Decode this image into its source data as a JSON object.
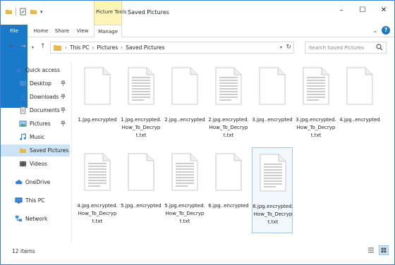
{
  "window": {
    "title": "Saved Pictures",
    "context_group": "Picture Tools",
    "controls": [
      "–",
      "☐",
      "✕"
    ]
  },
  "ribbon": {
    "tabs": [
      {
        "label": "File"
      },
      {
        "label": "Home"
      },
      {
        "label": "Share"
      },
      {
        "label": "View"
      },
      {
        "label": "Manage"
      }
    ],
    "expand_glyph": "⌄",
    "help_glyph": "?"
  },
  "address": {
    "crumbs": [
      "This PC",
      "Pictures",
      "Saved Pictures"
    ],
    "chevron": "›",
    "nav_back": "←",
    "nav_forward": "→",
    "nav_up": "↑",
    "nav_dropdown": "▾",
    "refresh": "↻"
  },
  "search": {
    "placeholder": "Search Saved Pictures"
  },
  "sidebar": {
    "items": [
      {
        "label": "Quick access",
        "icon": "star-icon",
        "pinned": false
      },
      {
        "label": "Desktop",
        "icon": "desktop-folder-icon",
        "pinned": true
      },
      {
        "label": "Downloads",
        "icon": "downloads-folder-icon",
        "pinned": true
      },
      {
        "label": "Documents",
        "icon": "documents-folder-icon",
        "pinned": true
      },
      {
        "label": "Pictures",
        "icon": "pictures-folder-icon",
        "pinned": true
      },
      {
        "label": "Music",
        "icon": "music-folder-icon",
        "pinned": false
      },
      {
        "label": "Saved Pictures",
        "icon": "folder-icon",
        "pinned": false,
        "selected": true
      },
      {
        "label": "Videos",
        "icon": "videos-folder-icon",
        "pinned": false
      },
      {
        "label": "OneDrive",
        "icon": "cloud-icon",
        "pinned": false
      },
      {
        "label": "This PC",
        "icon": "computer-icon",
        "pinned": false
      },
      {
        "label": "Network",
        "icon": "network-icon",
        "pinned": false
      }
    ]
  },
  "files": [
    {
      "name": "1.jpg.encrypted",
      "type": "blank"
    },
    {
      "name": "1.jpg.encrypted.How_To_Decrypt.txt",
      "type": "text"
    },
    {
      "name": "2.jpg..encrypted",
      "type": "blank"
    },
    {
      "name": "2.jpg.encrypted.How_To_Decrypt.txt",
      "type": "text"
    },
    {
      "name": "3.jpg..encrypted",
      "type": "blank"
    },
    {
      "name": "3.jpg.encrypted.How_To_Decrypt.txt",
      "type": "text"
    },
    {
      "name": "4.jpg..encrypted",
      "type": "blank"
    },
    {
      "name": "4.jpg.encrypted.How_To_Decrypt.txt",
      "type": "text"
    },
    {
      "name": "5.jpg..encrypted",
      "type": "blank"
    },
    {
      "name": "5.jpg.encrypted.How_To_Decrypt.txt",
      "type": "text"
    },
    {
      "name": "6.jpg..encrypted",
      "type": "blank"
    },
    {
      "name": "6.jpg.encrypted.How_To_Decrypt.txt",
      "type": "text",
      "selected": true
    }
  ],
  "status": {
    "item_count": "12 items"
  },
  "colors": {
    "accent": "#1979ca",
    "selection": "#cce4f7",
    "context_tab": "#fff5b8"
  }
}
